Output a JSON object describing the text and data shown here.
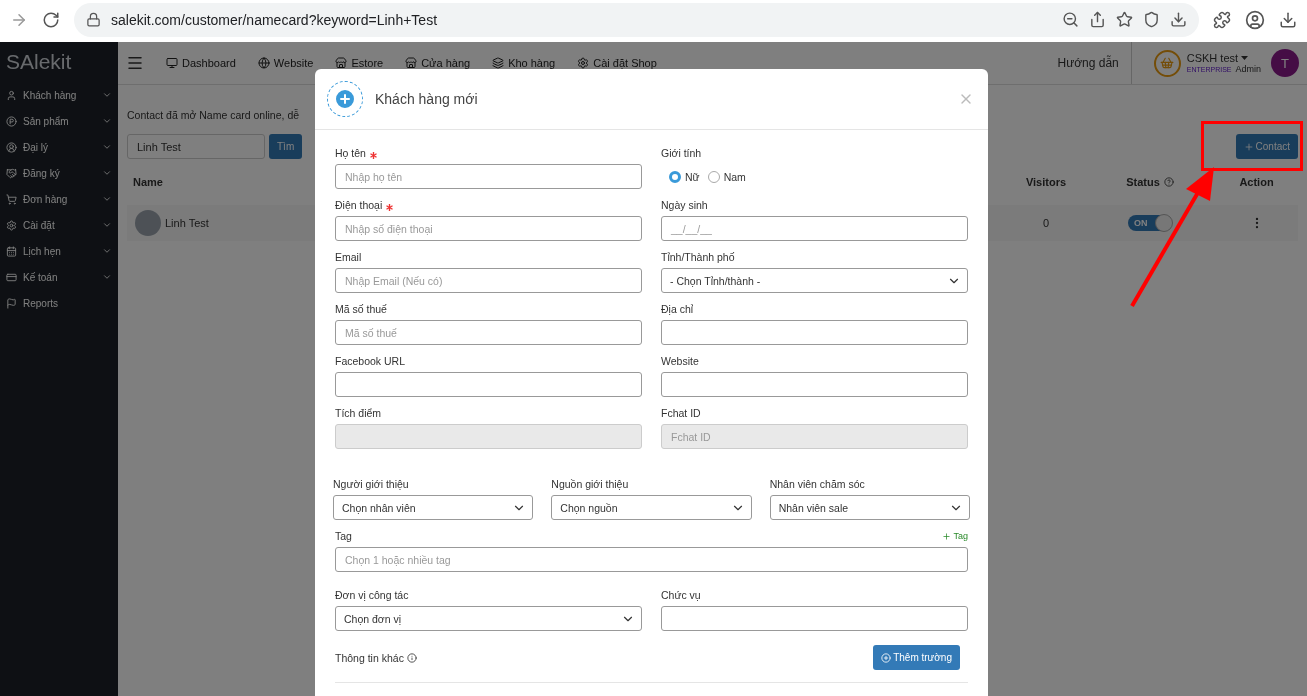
{
  "browser": {
    "url": "salekit.com/customer/namecard?keyword=Linh+Test"
  },
  "sidebar": {
    "logo": "SAlekit",
    "items": [
      {
        "label": "Khách hàng",
        "expandable": true
      },
      {
        "label": "Sản phẩm",
        "expandable": true
      },
      {
        "label": "Đại lý",
        "expandable": true
      },
      {
        "label": "Đăng ký",
        "expandable": true
      },
      {
        "label": "Đơn hàng",
        "expandable": true
      },
      {
        "label": "Cài đặt",
        "expandable": true
      },
      {
        "label": "Lịch hẹn",
        "expandable": true
      },
      {
        "label": "Kế toán",
        "expandable": true
      },
      {
        "label": "Reports",
        "expandable": false
      }
    ]
  },
  "topnav": {
    "items": [
      "Dashboard",
      "Website",
      "Estore",
      "Cửa hàng",
      "Kho hàng",
      "Cài đặt Shop"
    ],
    "help": "Hướng dẫn",
    "user": {
      "name": "CSKH test",
      "plan": "ENTERPRISE",
      "role": "Admin",
      "initial": "T"
    }
  },
  "page": {
    "description": "Contact đã mở Name card online, dễ",
    "search": {
      "value": "Linh Test",
      "button": "Tìm"
    },
    "add_button": "Contact",
    "table": {
      "columns": [
        "Name",
        "Visitors",
        "Status",
        "Action"
      ],
      "rows": [
        {
          "name": "Linh Test",
          "visitors": "0",
          "status": "ON",
          "on": true
        }
      ]
    }
  },
  "modal": {
    "title": "Khách hàng mới",
    "fields": [
      {
        "kind": "text",
        "label": "Họ tên",
        "required": true,
        "placeholder": "Nhập họ tên"
      },
      {
        "kind": "radio",
        "label": "Giới tính",
        "options": [
          {
            "label": "Nữ",
            "selected": true
          },
          {
            "label": "Nam",
            "selected": false
          }
        ]
      },
      {
        "kind": "text",
        "label": "Điện thoại",
        "required": true,
        "placeholder": "Nhập số điện thoại"
      },
      {
        "kind": "text",
        "label": "Ngày sinh",
        "required": false,
        "placeholder": "__/__/__"
      },
      {
        "kind": "text",
        "label": "Email",
        "required": false,
        "placeholder": "Nhập Email (Nếu có)"
      },
      {
        "kind": "select",
        "label": "Tỉnh/Thành phố",
        "value": "- Chọn Tỉnh/thành -"
      },
      {
        "kind": "text",
        "label": "Mã số thuế",
        "required": false,
        "placeholder": "Mã số thuế"
      },
      {
        "kind": "text",
        "label": "Địa chỉ",
        "required": false
      },
      {
        "kind": "text",
        "label": "Facebook URL",
        "required": false
      },
      {
        "kind": "text",
        "label": "Website",
        "required": false
      },
      {
        "kind": "disabled",
        "label": "Tích điểm"
      },
      {
        "kind": "disabled",
        "label": "Fchat ID",
        "placeholder": "Fchat ID"
      }
    ],
    "selects": [
      {
        "label": "Người giới thiệu",
        "value": "Chọn nhân viên"
      },
      {
        "label": "Nguồn giới thiệu",
        "value": "Chọn nguồn"
      },
      {
        "label": "Nhân viên chăm sóc",
        "value": "Nhân viên sale"
      }
    ],
    "tag": {
      "label": "Tag",
      "add": "Tag",
      "placeholder": "Chọn 1 hoặc nhiều tag"
    },
    "bottom": [
      {
        "kind": "select",
        "label": "Đơn vị công tác",
        "value": "Chọn đơn vị"
      },
      {
        "kind": "text",
        "label": "Chức vụ",
        "required": false
      }
    ],
    "more": {
      "label": "Thông tin khác",
      "button": "Thêm trường"
    }
  }
}
